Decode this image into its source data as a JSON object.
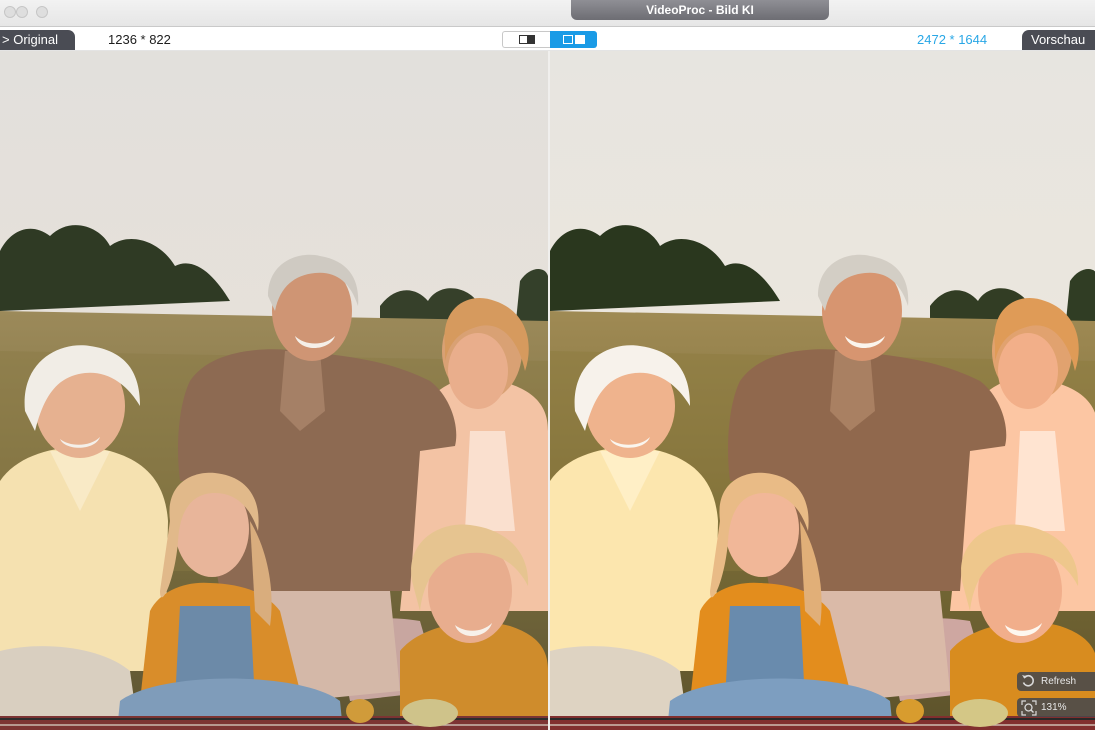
{
  "window": {
    "title": "VideoProc - Bild KI"
  },
  "toolbar": {
    "original_label": "> Original",
    "original_resolution": "1236 * 822",
    "preview_resolution": "2472 * 1644",
    "preview_label": "Vorschau",
    "view_mode": "split"
  },
  "controls": {
    "refresh_label": "Refresh",
    "zoom_label": "131%"
  },
  "colors": {
    "accent": "#1a9be6",
    "resolution_blue": "#29a7e6",
    "tag_bg": "#4a4c54"
  },
  "icons": [
    "single-view-icon",
    "split-view-icon",
    "refresh-icon",
    "zoom-icon"
  ]
}
